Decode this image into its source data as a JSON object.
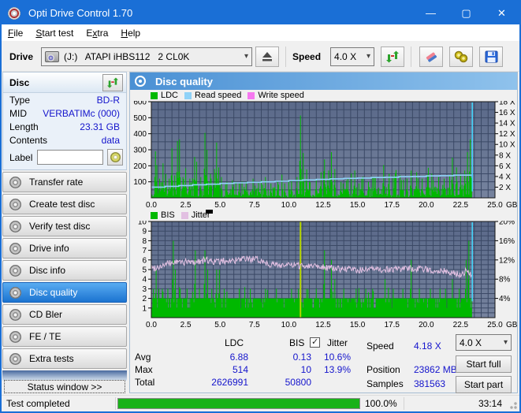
{
  "window": {
    "title": "Opti Drive Control 1.70",
    "controls": {
      "minimize": "—",
      "maximize": "▢",
      "close": "✕"
    }
  },
  "menu": {
    "items": [
      {
        "label": "File",
        "mnemonic": "F"
      },
      {
        "label": "Start test",
        "mnemonic": "S"
      },
      {
        "label": "Extra",
        "mnemonic": "x"
      },
      {
        "label": "Help",
        "mnemonic": "H"
      }
    ]
  },
  "toolbar": {
    "drive_label": "Drive",
    "drive_value": "(J:)   ATAPI iHBS112   2 CL0K",
    "speed_label": "Speed",
    "speed_value": "4.0 X",
    "icons": [
      "eject",
      "refresh-arrows",
      "eraser",
      "tools",
      "floppy-save"
    ]
  },
  "sidebar": {
    "panel_title": "Disc",
    "rescan_icon": "refresh-arrows",
    "info": [
      {
        "label": "Type",
        "value": "BD-R"
      },
      {
        "label": "MID",
        "value": "VERBATIMc (000)"
      },
      {
        "label": "Length",
        "value": "23.31 GB"
      },
      {
        "label": "Contents",
        "value": "data"
      }
    ],
    "label_field": {
      "label": "Label",
      "value": "",
      "icon": "disc"
    },
    "buttons": [
      {
        "label": "Transfer rate"
      },
      {
        "label": "Create test disc"
      },
      {
        "label": "Verify test disc"
      },
      {
        "label": "Drive info"
      },
      {
        "label": "Disc info"
      },
      {
        "label": "Disc quality"
      },
      {
        "label": "CD Bler"
      },
      {
        "label": "FE / TE"
      },
      {
        "label": "Extra tests"
      }
    ],
    "active_button": "Disc quality",
    "status_window_label": "Status window >>"
  },
  "main": {
    "header": "Disc quality"
  },
  "colors": {
    "ldc_green": "#00b800",
    "read_speed_blue": "#8fd2f8",
    "write_speed_pink": "#f678f0",
    "bis_green": "#00b800",
    "jitter_pink": "#e2c0e2",
    "end_marker_cyan": "#45d2f8",
    "big_spike_olive": "#b6d400",
    "plot_top": "#5a6989",
    "plot_bottom": "#76839e",
    "grid": "#3b4966",
    "value_blue": "#1414cc",
    "progress_green": "#19b219"
  },
  "chart_data": [
    {
      "type": "bar+line",
      "name": "ldc-readspeed-chart",
      "legend": [
        "LDC",
        "Read speed",
        "Write speed"
      ],
      "legend_colors": [
        "#00b800",
        "#8fd2f8",
        "#f678f0"
      ],
      "xlim": [
        0,
        25
      ],
      "x_ticks": [
        0,
        2.5,
        5,
        7.5,
        10,
        12.5,
        15,
        17.5,
        20,
        22.5,
        25
      ],
      "x_unit": "GB",
      "left_axis": {
        "lim": [
          0,
          600
        ],
        "tick_step": 100,
        "grid_step": 50
      },
      "right_axis": {
        "lim": [
          0,
          18
        ],
        "tick_step": 2,
        "suffix": " X"
      },
      "data_end_x": 23.35,
      "bar_series": "LDC",
      "ldc_baseline": {
        "typical": [
          4,
          24
        ],
        "frequent_spikes": [
          25,
          130
        ]
      },
      "ldc_major_spikes": [
        [
          0.28,
          290
        ],
        [
          0.42,
          205
        ],
        [
          0.6,
          120
        ],
        [
          0.85,
          215
        ],
        [
          1.05,
          150
        ],
        [
          1.3,
          120
        ],
        [
          1.5,
          310
        ],
        [
          1.7,
          140
        ],
        [
          1.9,
          355
        ],
        [
          2.05,
          365
        ],
        [
          2.3,
          130
        ],
        [
          2.5,
          185
        ],
        [
          2.8,
          120
        ],
        [
          3.15,
          255
        ],
        [
          3.3,
          225
        ],
        [
          3.6,
          130
        ],
        [
          3.9,
          405
        ],
        [
          4.05,
          300
        ],
        [
          4.3,
          150
        ],
        [
          4.6,
          180
        ],
        [
          4.75,
          345
        ],
        [
          4.9,
          190
        ],
        [
          5.1,
          130
        ],
        [
          5.5,
          100
        ],
        [
          5.9,
          110
        ],
        [
          6.4,
          90
        ],
        [
          6.9,
          100
        ],
        [
          7.4,
          120
        ],
        [
          7.8,
          100
        ],
        [
          8.3,
          130
        ],
        [
          8.7,
          90
        ],
        [
          9.2,
          100
        ],
        [
          9.7,
          90
        ],
        [
          10.2,
          110
        ],
        [
          10.6,
          130
        ],
        [
          10.85,
          514
        ],
        [
          11.05,
          280
        ],
        [
          11.5,
          100
        ],
        [
          12.0,
          120
        ],
        [
          12.35,
          160
        ],
        [
          12.6,
          240
        ],
        [
          12.9,
          170
        ],
        [
          13.1,
          285
        ],
        [
          13.35,
          180
        ],
        [
          13.8,
          100
        ],
        [
          14.3,
          120
        ],
        [
          14.8,
          170
        ],
        [
          15.3,
          120
        ],
        [
          15.8,
          100
        ],
        [
          16.3,
          130
        ],
        [
          16.9,
          205
        ],
        [
          17.3,
          150
        ],
        [
          17.7,
          130
        ],
        [
          18.2,
          110
        ],
        [
          18.6,
          120
        ],
        [
          18.9,
          170
        ],
        [
          19.3,
          160
        ],
        [
          19.7,
          120
        ],
        [
          20.1,
          145
        ],
        [
          20.5,
          110
        ],
        [
          20.9,
          130
        ],
        [
          21.3,
          120
        ],
        [
          21.7,
          140
        ],
        [
          21.9,
          250
        ],
        [
          22.2,
          190
        ],
        [
          22.5,
          150
        ],
        [
          22.8,
          170
        ],
        [
          23.0,
          285
        ],
        [
          23.2,
          365
        ]
      ],
      "read_speed_points_x_speed": [
        [
          0,
          2.0
        ],
        [
          1,
          2.15
        ],
        [
          2,
          2.3
        ],
        [
          3,
          2.45
        ],
        [
          4,
          2.55
        ],
        [
          5,
          2.7
        ],
        [
          6,
          2.8
        ],
        [
          7,
          2.9
        ],
        [
          8,
          3.0
        ],
        [
          9,
          3.1
        ],
        [
          10,
          3.25
        ],
        [
          11,
          3.35
        ],
        [
          12,
          3.45
        ],
        [
          13,
          3.55
        ],
        [
          14,
          3.65
        ],
        [
          15,
          3.7
        ],
        [
          16,
          3.8
        ],
        [
          17,
          3.85
        ],
        [
          18,
          3.95
        ],
        [
          19,
          4.0
        ],
        [
          20,
          4.1
        ],
        [
          21,
          4.15
        ],
        [
          22,
          4.25
        ],
        [
          23.3,
          4.3
        ]
      ],
      "end_spike_to_speed": 18
    },
    {
      "type": "bar+line",
      "name": "bis-jitter-chart",
      "legend": [
        "BIS",
        "Jitter"
      ],
      "legend_colors": [
        "#00b800",
        "#e2c0e2"
      ],
      "xlim": [
        0,
        25
      ],
      "x_ticks": [
        0,
        2.5,
        5,
        7.5,
        10,
        12.5,
        15,
        17.5,
        20,
        22.5,
        25
      ],
      "x_unit": "GB",
      "left_axis": {
        "lim": [
          0,
          10
        ],
        "tick_step": 1,
        "grid_step": 0.5
      },
      "right_axis": {
        "lim": [
          0,
          20
        ],
        "tick_step": 4,
        "suffix": "%"
      },
      "data_end_x": 23.35,
      "bar_series": "BIS",
      "bis_baseline_level": 2,
      "bis_major_spikes": [
        [
          0.15,
          3
        ],
        [
          0.35,
          5
        ],
        [
          0.55,
          3
        ],
        [
          0.8,
          3
        ],
        [
          1.2,
          3
        ],
        [
          1.6,
          8
        ],
        [
          1.75,
          5
        ],
        [
          2.1,
          3
        ],
        [
          2.6,
          3
        ],
        [
          3.2,
          7
        ],
        [
          3.5,
          3
        ],
        [
          3.9,
          7
        ],
        [
          4.1,
          5
        ],
        [
          4.4,
          3
        ],
        [
          4.75,
          5
        ],
        [
          4.95,
          5
        ],
        [
          5.3,
          3
        ],
        [
          6.4,
          3
        ],
        [
          7.2,
          3
        ],
        [
          8.3,
          3
        ],
        [
          9.1,
          3
        ],
        [
          10.2,
          3
        ],
        [
          11.3,
          3
        ],
        [
          12.0,
          3
        ],
        [
          12.6,
          7
        ],
        [
          13.1,
          6
        ],
        [
          13.35,
          4
        ],
        [
          14.0,
          3
        ],
        [
          14.9,
          3
        ],
        [
          15.6,
          3
        ],
        [
          16.1,
          3
        ],
        [
          17.0,
          4
        ],
        [
          17.6,
          3
        ],
        [
          18.3,
          3
        ],
        [
          18.9,
          6
        ],
        [
          19.5,
          3
        ],
        [
          20.3,
          3
        ],
        [
          21.0,
          3
        ],
        [
          21.4,
          3
        ],
        [
          21.9,
          4
        ],
        [
          22.4,
          3
        ],
        [
          22.9,
          6
        ],
        [
          23.1,
          8
        ]
      ],
      "bis_full_spike": {
        "x": 10.85,
        "value": 10
      },
      "jitter_points": [
        [
          0,
          5.1
        ],
        [
          0.5,
          5.3
        ],
        [
          1,
          5.5
        ],
        [
          1.5,
          5.7
        ],
        [
          2,
          5.8
        ],
        [
          3,
          5.75
        ],
        [
          4,
          6.0
        ],
        [
          4.5,
          5.85
        ],
        [
          5,
          5.8
        ],
        [
          5.5,
          5.95
        ],
        [
          6,
          5.9
        ],
        [
          6.5,
          6.0
        ],
        [
          7,
          6.1
        ],
        [
          7.5,
          6.05
        ],
        [
          8,
          5.95
        ],
        [
          8.5,
          5.6
        ],
        [
          9,
          5.5
        ],
        [
          10,
          5.45
        ],
        [
          11,
          5.4
        ],
        [
          12,
          5.45
        ],
        [
          13,
          5.15
        ],
        [
          14,
          5.05
        ],
        [
          15,
          4.95
        ],
        [
          16,
          5.0
        ],
        [
          17,
          5.0
        ],
        [
          18,
          5.05
        ],
        [
          19,
          5.1
        ],
        [
          20,
          5.0
        ],
        [
          21,
          4.9
        ],
        [
          21.5,
          4.8
        ],
        [
          22,
          4.6
        ],
        [
          22.5,
          4.5
        ],
        [
          23,
          4.9
        ],
        [
          23.35,
          4.4
        ]
      ]
    }
  ],
  "stats": {
    "col_headers": {
      "ldc": "LDC",
      "bis": "BIS",
      "jitter": "Jitter"
    },
    "jitter_checkbox_checked": true,
    "rows": [
      {
        "name": "Avg",
        "ldc": "6.88",
        "bis": "0.13",
        "jitter": "10.6%"
      },
      {
        "name": "Max",
        "ldc": "514",
        "bis": "10",
        "jitter": "13.9%"
      },
      {
        "name": "Total",
        "ldc": "2626991",
        "bis": "50800",
        "jitter": ""
      }
    ],
    "right": [
      {
        "label": "Speed",
        "value": "4.18 X"
      },
      {
        "label": "Position",
        "value": "23862 MB"
      },
      {
        "label": "Samples",
        "value": "381563"
      }
    ],
    "speed_select_value": "4.0 X",
    "start_full_label": "Start full",
    "start_part_label": "Start part"
  },
  "statusbar": {
    "status": "Test completed",
    "progress_percent": "100.0%",
    "time": "33:14"
  }
}
